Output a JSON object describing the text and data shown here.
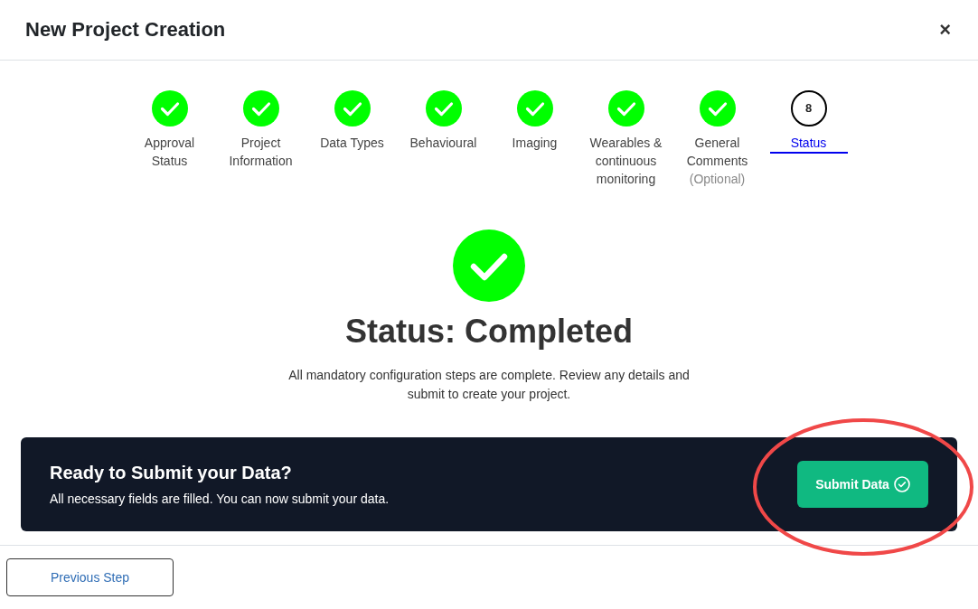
{
  "dialog": {
    "title": "New Project Creation",
    "close": "×"
  },
  "steps": [
    {
      "label": "Approval Status",
      "completed": true,
      "selected": false
    },
    {
      "label": "Project Information",
      "completed": true,
      "selected": false
    },
    {
      "label": "Data Types",
      "completed": true,
      "selected": false
    },
    {
      "label": "Behavioural",
      "completed": true,
      "selected": false
    },
    {
      "label": "Imaging",
      "completed": true,
      "selected": false
    },
    {
      "label": "Wearables & continuous monitoring",
      "completed": true,
      "selected": false
    },
    {
      "label": "General Comments",
      "note": "(Optional)",
      "completed": true,
      "selected": false
    },
    {
      "label": "Status",
      "number": "8",
      "completed": false,
      "selected": true
    }
  ],
  "status": {
    "completed": true,
    "heading": "Status: Completed",
    "message": "All mandatory configuration steps are complete. Review any details and submit to create your project."
  },
  "submit_panel": {
    "title": "Ready to Submit your Data?",
    "message": "All necessary fields are filled. You can now submit your data.",
    "button": "Submit Data"
  },
  "footer": {
    "previous_button": "Previous Step"
  },
  "annotation": {
    "kind": "ellipse"
  }
}
